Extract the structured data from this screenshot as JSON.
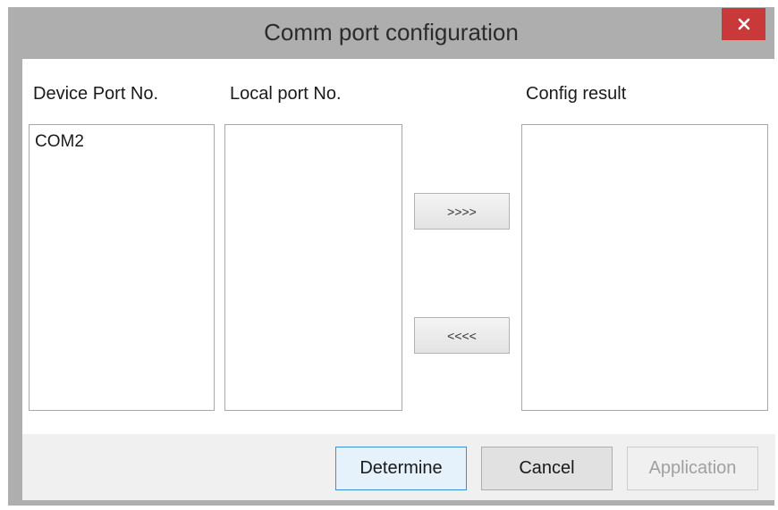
{
  "window": {
    "title": "Comm port configuration"
  },
  "columns": {
    "device_port_label": "Device Port No.",
    "local_port_label": "Local port No.",
    "config_result_label": "Config result"
  },
  "lists": {
    "device_ports": [
      "COM2"
    ],
    "local_ports": [],
    "config_results": []
  },
  "move_buttons": {
    "add_label": ">>>>",
    "remove_label": "<<<<"
  },
  "footer": {
    "determine_label": "Determine",
    "cancel_label": "Cancel",
    "apply_label": "Application",
    "apply_enabled": false
  },
  "colors": {
    "close_button": "#c9393a",
    "title_bar": "#aeaeae",
    "default_button_border": "#3c8fd6"
  }
}
